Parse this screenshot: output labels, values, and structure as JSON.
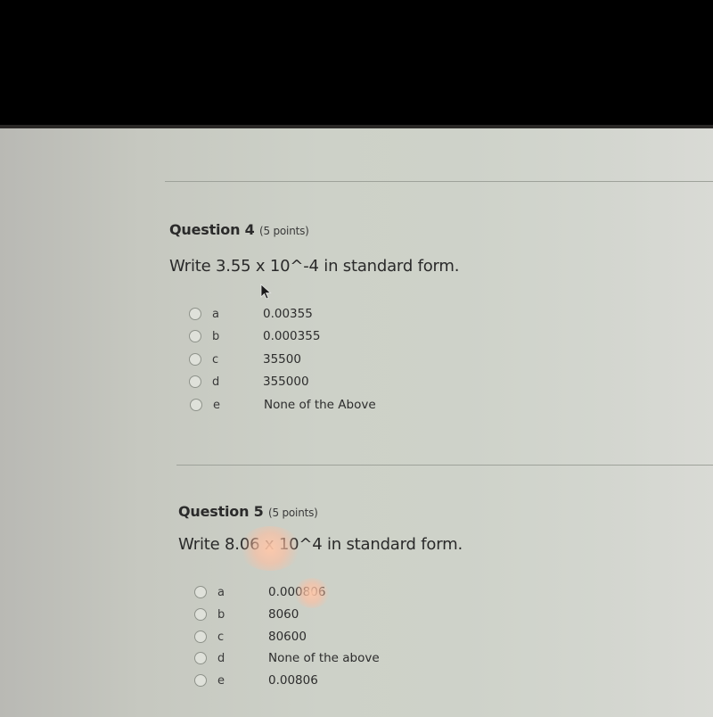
{
  "questions": [
    {
      "title": "Question 4",
      "points": "(5 points)",
      "prompt": "Write 3.55 x 10^-4 in standard form.",
      "options": [
        {
          "letter": "a",
          "text": "0.00355"
        },
        {
          "letter": "b",
          "text": "0.000355"
        },
        {
          "letter": "c",
          "text": "35500"
        },
        {
          "letter": "d",
          "text": "355000"
        },
        {
          "letter": "e",
          "text": "None of the Above"
        }
      ]
    },
    {
      "title": "Question 5",
      "points": "(5 points)",
      "prompt": "Write 8.06 x 10^4 in standard form.",
      "options": [
        {
          "letter": "a",
          "text": "0.000806"
        },
        {
          "letter": "b",
          "text": "8060"
        },
        {
          "letter": "c",
          "text": "80600"
        },
        {
          "letter": "d",
          "text": "None of the above"
        },
        {
          "letter": "e",
          "text": "0.00806"
        }
      ]
    }
  ],
  "colors": {
    "text": "#2b2b2b",
    "page_bg": "#cdd1c8",
    "bezel": "#000000"
  }
}
